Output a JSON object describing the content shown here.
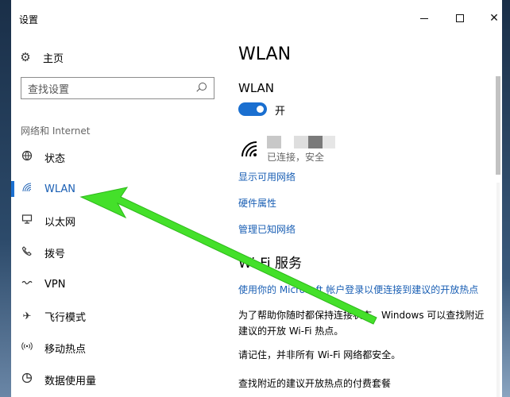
{
  "window": {
    "title": "设置"
  },
  "sidebar": {
    "home_label": "主页",
    "search_placeholder": "查找设置",
    "section_label": "网络和 Internet",
    "items": [
      {
        "label": "状态",
        "icon": "globe-icon"
      },
      {
        "label": "WLAN",
        "icon": "wifi-icon",
        "active": true
      },
      {
        "label": "以太网",
        "icon": "ethernet-icon"
      },
      {
        "label": "拨号",
        "icon": "phone-icon"
      },
      {
        "label": "VPN",
        "icon": "vpn-icon"
      },
      {
        "label": "飞行模式",
        "icon": "airplane-icon"
      },
      {
        "label": "移动热点",
        "icon": "hotspot-icon"
      },
      {
        "label": "数据使用量",
        "icon": "data-usage-icon"
      }
    ]
  },
  "main": {
    "title": "WLAN",
    "wlan_label": "WLAN",
    "toggle_state": "开",
    "network_status": "已连接，安全",
    "links": [
      "显示可用网络",
      "硬件属性",
      "管理已知网络"
    ],
    "wifi_services_title": "Wi-Fi 服务",
    "service_link": "使用你的 Microsoft 帐户登录以便连接到建议的开放热点",
    "paragraph1": "为了帮助你随时都保持连接状态，Windows 可以查找附近建议的开放 Wi-Fi 热点。",
    "paragraph2": "请记住，并非所有 Wi-Fi 网络都安全。",
    "paragraph3": "查找附近的建议开放热点的付费套餐"
  },
  "colors": {
    "accent": "#1a6fd0",
    "link": "#1a5fb4",
    "arrow": "#44e02a"
  }
}
